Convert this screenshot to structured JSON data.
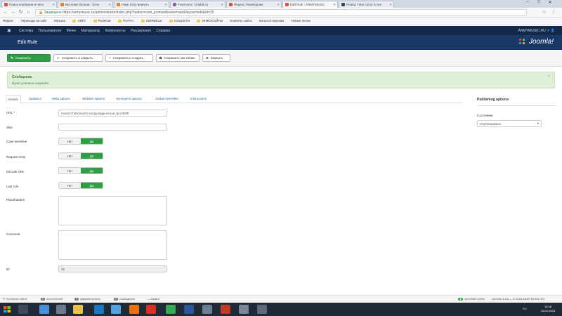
{
  "browser": {
    "tabs": [
      {
        "label": "Поиск альбомов и песн",
        "color": "#d9534f"
      },
      {
        "label": "Виталий Леонов - Хочу",
        "color": "#e67e22"
      },
      {
        "label": "Гимн Хочу вернуть",
        "color": "#e67e22"
      },
      {
        "label": "Fixed error 'Unable to",
        "color": "#9b59b6"
      },
      {
        "label": "Яндекс Переводчик",
        "color": "#d9534f"
      },
      {
        "label": "Edit Rule - ARMYMUSIC",
        "color": "#e74c3c"
      },
      {
        "label": "Replay Tube come to me",
        "color": "#34495e"
      }
    ],
    "url_secure_label": "Защищено",
    "url": "https://armymusic.ru/administrator/index.php?option=com_joomsef&view=rule&layout=edit&id=35",
    "bookmarks": [
      "Яндекс",
      "Переходи на сайт",
      "Музыка",
      "АВТО",
      "РАЗНОЕ",
      "ПОЧТА",
      "СЕРВИСЫ",
      "СОЦСЕТИ",
      "ИНФОСАЙТЫ",
      "Клиенты сайта",
      "Каталоги музыки",
      "Новые песни"
    ]
  },
  "joomla": {
    "topmenu": [
      "Система",
      "Пользователи",
      "Меню",
      "Материалы",
      "Компоненты",
      "Расширения",
      "Справка"
    ],
    "site_name": "ARMYMUSIC.RU",
    "page_title": "Edit Rule",
    "brand": "Joomla!",
    "toolbar": {
      "save": "Сохранить",
      "save_close": "Сохранить и закрыть",
      "save_new": "Сохранить и создать",
      "save_copy": "Сохранить как копию",
      "close": "Закрыть"
    },
    "message": {
      "heading": "Сообщение",
      "body": "Пункт успешно сохранён."
    },
    "form_tabs": [
      "Details",
      "Statistics",
      "Meta options",
      "Website options",
      "Synonyms options",
      "Global overrides",
      "Instructions"
    ],
    "fields": {
      "url_label": "URL *",
      "url_value": "/search-hits/search-songs/saga-песни про ВМФ",
      "skip_label": "Skip",
      "skip_value": "",
      "case_label": "Case sensitive",
      "request_label": "Request Only",
      "decode_label": "Decode URL",
      "last_label": "Last rule",
      "placeholders_label": "Placeholders",
      "comment_label": "Comment",
      "id_label": "ID",
      "id_value": "35",
      "toggle_no": "Нет",
      "toggle_yes": "Да"
    },
    "publishing": {
      "heading": "Publishing options",
      "state_label": "Состояние",
      "state_value": "Опубликовано"
    },
    "statusbar": {
      "view_site": "Просмотр сайта",
      "visitors_count": "0",
      "visitors": "посетителей",
      "admins_count": "1",
      "admins": "Администратор",
      "messages_count": "0",
      "messages": "Сообщения",
      "logout": "Выйти",
      "joomsef": "JoomSEF",
      "joomsef_status": "Active",
      "version": "Joomla! 3.8.6 — © 2018 ARMYMUSIC.RU"
    }
  },
  "taskbar": {
    "lang": "RU",
    "time": "16:38",
    "date": "15.04.2018"
  },
  "colors": {
    "joomla_topbar": "#13294b",
    "joomla_header": "#1a3867",
    "save_green": "#2f9e45",
    "message_bg": "#dff0d8"
  }
}
